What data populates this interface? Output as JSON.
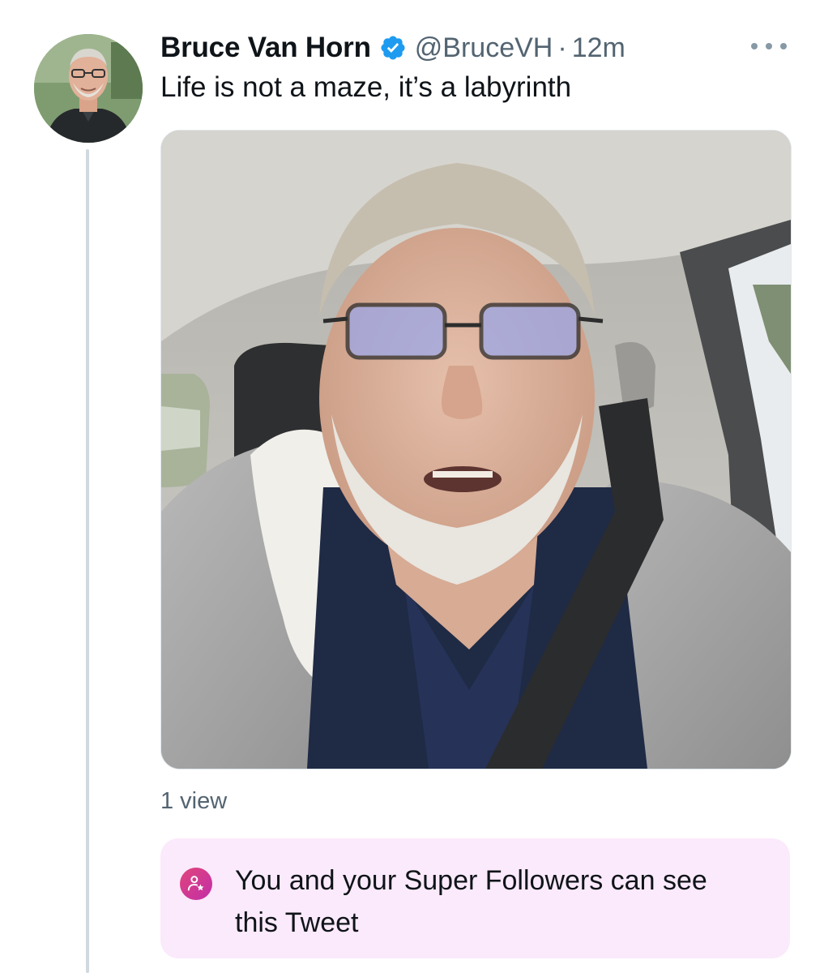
{
  "tweet": {
    "author_name": "Bruce Van Horn",
    "handle": "@BruceVH",
    "separator": "·",
    "time": "12m",
    "text": "Life is not a maze, it’s a labyrinth",
    "verified": true,
    "views": "1 view",
    "audience_notice": "You and your Super Followers can see this Tweet"
  },
  "icons": {
    "verified": "verified-badge-icon",
    "more": "more-options-icon",
    "super_follower": "super-follower-icon"
  },
  "colors": {
    "verified_blue": "#1d9bf0",
    "secondary_text": "#536471",
    "super_follow_bg": "#fbeafb",
    "super_follow_accent": "#d13b95"
  }
}
